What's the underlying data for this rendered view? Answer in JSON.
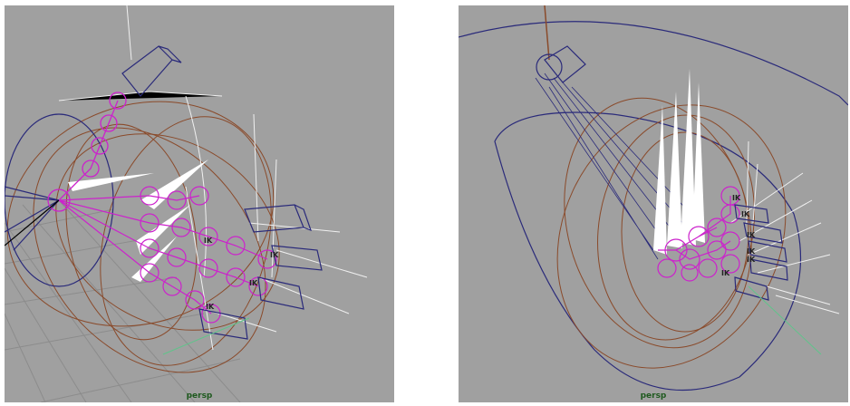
{
  "viewports": [
    {
      "camera": "persp",
      "ik_labels": [
        "IK",
        "IK",
        "IK",
        "IK"
      ]
    },
    {
      "camera": "persp",
      "ik_labels": [
        "IK",
        "IK",
        "IK",
        "IK",
        "IK",
        "IK"
      ]
    }
  ],
  "colors": {
    "background": "#a0a0a0",
    "grid": "#8a8a8a",
    "joint": "#cc22cc",
    "control": "#2a2a7a",
    "curve": "#8a4a2a",
    "highlight": "#ffffff"
  }
}
